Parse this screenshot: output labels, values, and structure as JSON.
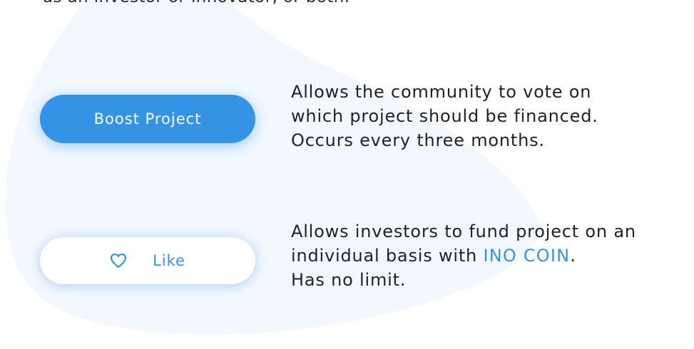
{
  "intro": {
    "text": "as an investor or innovator, or both."
  },
  "boost": {
    "button_label": "Boost Project",
    "description": [
      "Allows the community to vote on",
      "which project should be financed.",
      "Occurs every three months."
    ]
  },
  "like": {
    "button_label": "Like",
    "icon": "heart-outline-icon",
    "description_line1": "Allows investors to fund project on an",
    "description_line2_before": "individual basis with ",
    "description_line2_highlight": "INO COIN",
    "description_line2_after": ".",
    "description_line3": "Has no limit."
  },
  "colors": {
    "accent": "#3593e6",
    "blob": "#f2f8fe",
    "text": "#222222"
  }
}
